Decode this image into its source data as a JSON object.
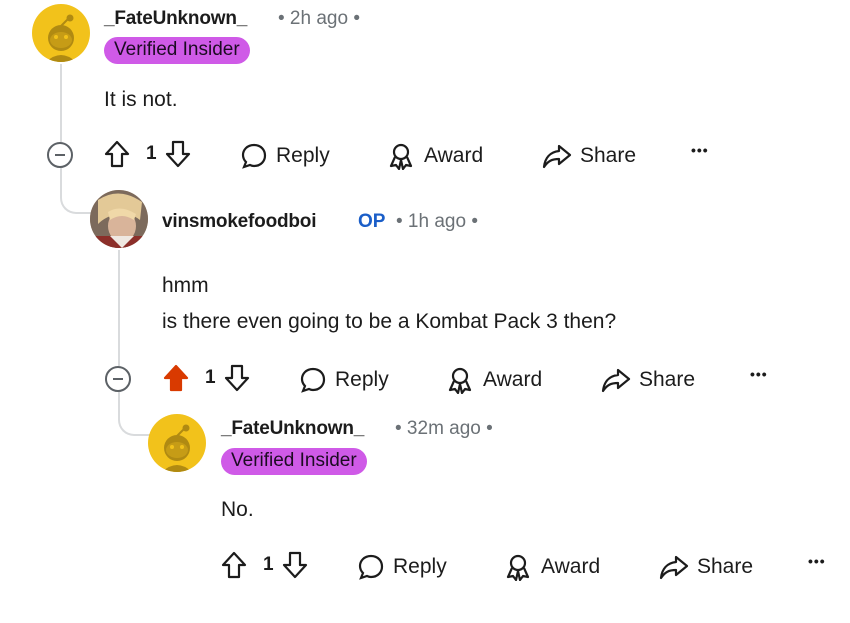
{
  "comments": [
    {
      "username": "_FateUnknown_",
      "time": "• 2h ago •",
      "flair": "Verified Insider",
      "body": [
        "It is not."
      ],
      "score": "1",
      "actions": {
        "reply": "Reply",
        "award": "Award",
        "share": "Share",
        "more": "•••"
      }
    },
    {
      "username": "vinsmokefoodboi",
      "op": "OP",
      "time": "• 1h ago •",
      "body": [
        "hmm",
        "is there even going to be a Kombat Pack 3 then?"
      ],
      "score": "1",
      "upvoted": true,
      "actions": {
        "reply": "Reply",
        "award": "Award",
        "share": "Share",
        "more": "•••"
      }
    },
    {
      "username": "_FateUnknown_",
      "time": "• 32m ago •",
      "flair": "Verified Insider",
      "body": [
        "No."
      ],
      "score": "1",
      "actions": {
        "reply": "Reply",
        "award": "Award",
        "share": "Share",
        "more": "•••"
      }
    }
  ],
  "colors": {
    "flair_bg": "#cf5ae7",
    "upvote_active": "#d93a00",
    "op_blue": "#1a5ec8",
    "snoo_yellow": "#f2c21b"
  }
}
